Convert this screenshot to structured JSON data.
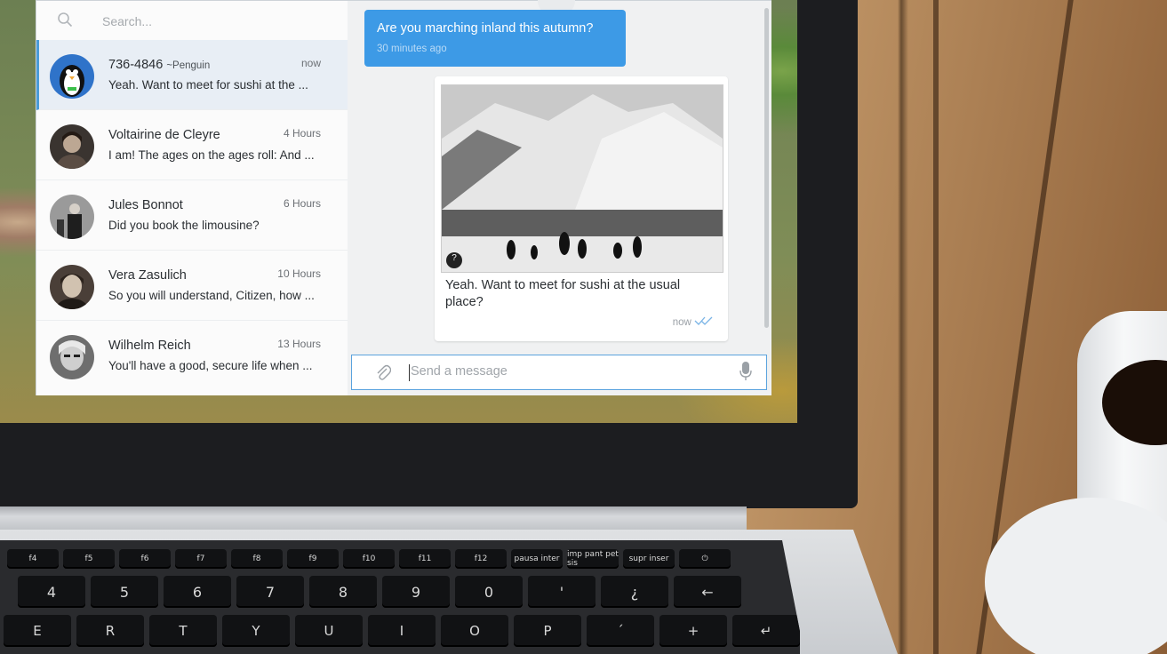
{
  "search": {
    "placeholder": "Search..."
  },
  "conversations": [
    {
      "name": "736-4846",
      "alias": "~Penguin",
      "time": "now",
      "preview": "Yeah. Want to meet for sushi at the ..."
    },
    {
      "name": "Voltairine de Cleyre",
      "time": "4 Hours",
      "preview": "I am! The ages on the ages roll: And ..."
    },
    {
      "name": "Jules Bonnot",
      "time": "6 Hours",
      "preview": "Did you book the limousine?"
    },
    {
      "name": "Vera Zasulich",
      "time": "10 Hours",
      "preview": "So you will understand, Citizen, how ..."
    },
    {
      "name": "Wilhelm Reich",
      "time": "13 Hours",
      "preview": "You'll have a good, secure life when ..."
    }
  ],
  "chat": {
    "incoming": {
      "text": "Are you marching inland this autumn?",
      "meta": "30 minutes ago"
    },
    "outgoing": {
      "text": "Yeah. Want to meet for sushi at the usual place?",
      "meta": "now",
      "photo_badge": "?"
    }
  },
  "composer": {
    "placeholder": "Send a message"
  },
  "keyboard": {
    "fn_row": [
      "f4",
      "f5",
      "f6",
      "f7",
      "f8",
      "f9",
      "f10",
      "f11",
      "f12",
      "pausa inter",
      "imp pant pet sis",
      "supr inser",
      "⏻"
    ],
    "num_row": [
      "4",
      "5",
      "6",
      "7",
      "8",
      "9",
      "0",
      "'",
      "¿",
      "←"
    ],
    "letter_row": [
      "E",
      "R",
      "T",
      "Y",
      "U",
      "I",
      "O",
      "P",
      "´",
      "+",
      "↵"
    ]
  },
  "colors": {
    "accent": "#3d9ae6",
    "active_row": "#e8eef5"
  }
}
